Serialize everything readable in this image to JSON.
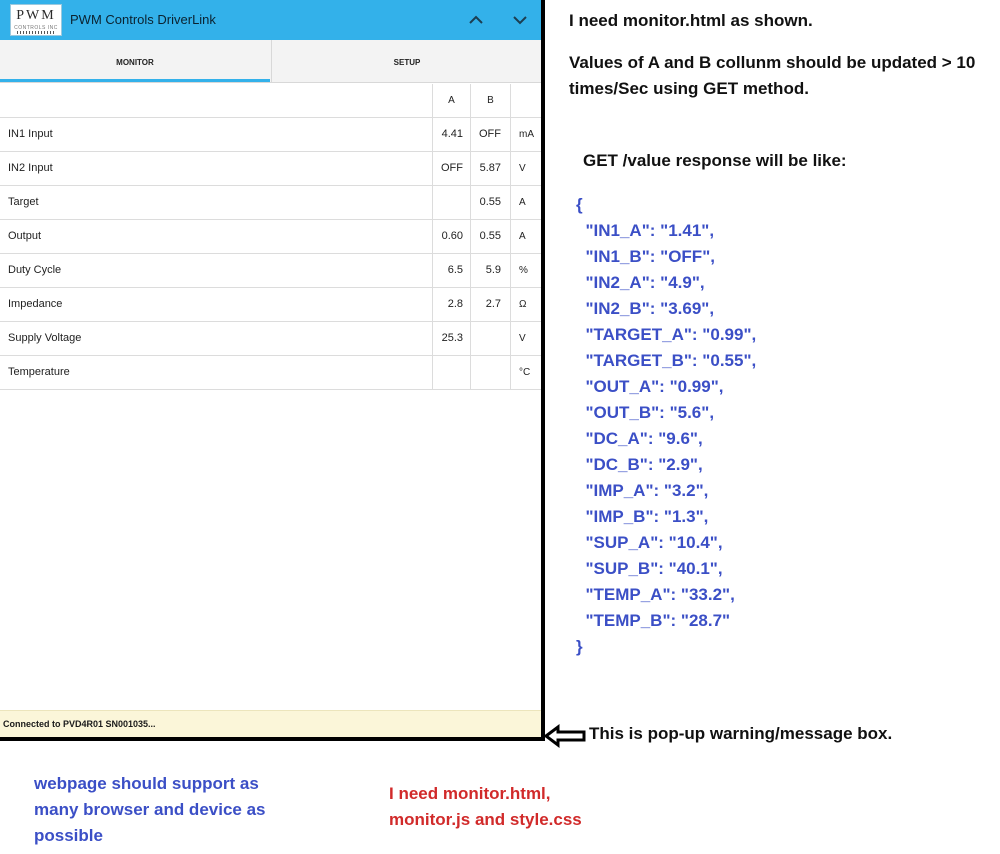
{
  "app": {
    "logo_text": "PWM",
    "logo_sub": "CONTROLS INC",
    "title": "PWM Controls DriverLink"
  },
  "tabs": [
    {
      "label": "MONITOR",
      "active": true
    },
    {
      "label": "SETUP",
      "active": false
    }
  ],
  "table": {
    "headers": {
      "label": "",
      "a": "A",
      "b": "B",
      "unit": ""
    },
    "rows": [
      {
        "label": "IN1 Input",
        "a": "4.41",
        "b": "OFF",
        "unit": "mA"
      },
      {
        "label": "IN2 Input",
        "a": "OFF",
        "b": "5.87",
        "unit": "V"
      },
      {
        "label": "Target",
        "a": "",
        "b": "0.55",
        "unit": "A"
      },
      {
        "label": "Output",
        "a": "0.60",
        "b": "0.55",
        "unit": "A"
      },
      {
        "label": "Duty Cycle",
        "a": "6.5",
        "b": "5.9",
        "unit": "%"
      },
      {
        "label": "Impedance",
        "a": "2.8",
        "b": "2.7",
        "unit": "Ω"
      },
      {
        "label": "Supply Voltage",
        "a": "25.3",
        "b": "",
        "unit": "V"
      },
      {
        "label": "Temperature",
        "a": "",
        "b": "",
        "unit": "°C"
      }
    ]
  },
  "status": {
    "message": "Connected to PVD4R01 SN001035..."
  },
  "annotations": {
    "note1": "I need monitor.html as shown.",
    "note2": "Values of A and B collunm should be updated > 10 times/Sec using GET method.",
    "note3": "GET /value response will be like:",
    "json": "{\n  \"IN1_A\": \"1.41\",\n  \"IN1_B\": \"OFF\",\n  \"IN2_A\": \"4.9\",\n  \"IN2_B\": \"3.69\",\n  \"TARGET_A\": \"0.99\",\n  \"TARGET_B\": \"0.55\",\n  \"OUT_A\": \"0.99\",\n  \"OUT_B\": \"5.6\",\n  \"DC_A\": \"9.6\",\n  \"DC_B\": \"2.9\",\n  \"IMP_A\": \"3.2\",\n  \"IMP_B\": \"1.3\",\n  \"SUP_A\": \"10.4\",\n  \"SUP_B\": \"40.1\",\n  \"TEMP_A\": \"33.2\",\n  \"TEMP_B\": \"28.7\"\n}",
    "note4": "This is pop-up warning/message box.",
    "note5": "webpage should support as many browser and device as possible",
    "note6": "I need monitor.html, monitor.js and style.css"
  },
  "colors": {
    "accent": "#33b1ea",
    "status_bg": "#fbf6d9",
    "note_blue": "#3b4fc6",
    "note_red": "#d12a2a"
  }
}
